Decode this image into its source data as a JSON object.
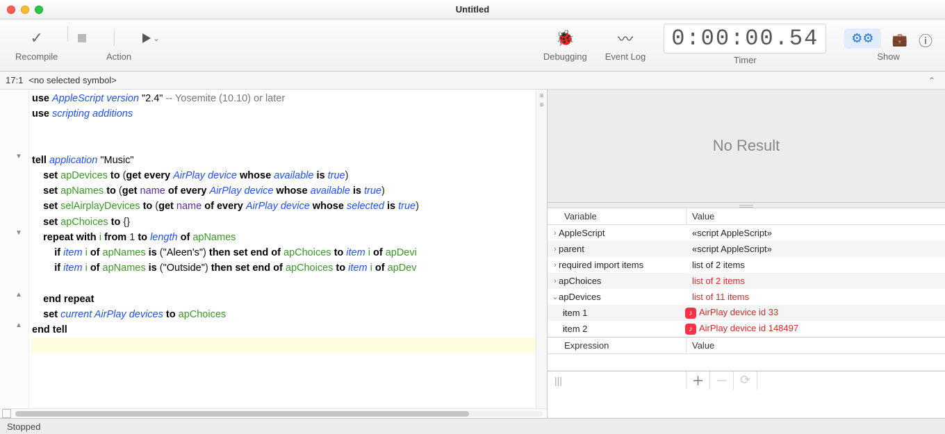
{
  "window": {
    "title": "Untitled"
  },
  "toolbar": {
    "recompile": "Recompile",
    "action": "Action",
    "debugging": "Debugging",
    "event_log": "Event Log",
    "timer_label": "Timer",
    "timer_value": "0:00:00.54",
    "show": "Show"
  },
  "nav": {
    "pos": "17:1",
    "symbol": "<no selected symbol>"
  },
  "code": {
    "version_str": "\"2.4\"",
    "yosemite_comment": "-- Yosemite (10.10) or later",
    "music_str": "\"Music\"",
    "aleen_str": "\"Aleen's\"",
    "outside_str": "\"Outside\"",
    "one": "1",
    "braces": "{}"
  },
  "result": {
    "text": "No Result"
  },
  "vars": {
    "col1": "Variable",
    "col2": "Value",
    "rows": [
      {
        "arrow": "›",
        "name": "AppleScript",
        "value": "«script AppleScript»",
        "red": false
      },
      {
        "arrow": "›",
        "name": "parent",
        "value": "«script AppleScript»",
        "red": false
      },
      {
        "arrow": "›",
        "name": "required import items",
        "value": "list of 2 items",
        "red": false
      },
      {
        "arrow": "›",
        "name": "apChoices",
        "value": "list of 2 items",
        "red": true
      },
      {
        "arrow": "⌄",
        "name": "apDevices",
        "value": "list of 11 items",
        "red": true
      }
    ],
    "children": [
      {
        "arrow": "›",
        "name": "item 1",
        "value": "AirPlay device id 33"
      },
      {
        "arrow": "›",
        "name": "item 2",
        "value": "AirPlay device id 148497"
      }
    ]
  },
  "expr": {
    "col1": "Expression",
    "col2": "Value"
  },
  "status": {
    "text": "Stopped"
  }
}
